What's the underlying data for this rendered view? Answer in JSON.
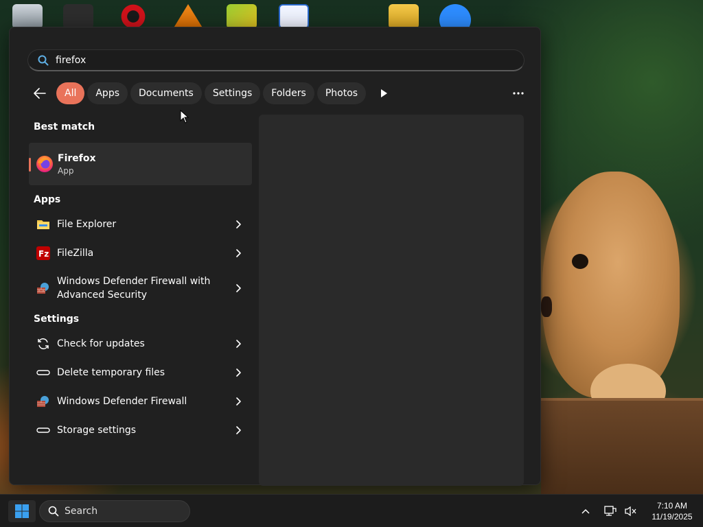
{
  "search": {
    "query": "firefox"
  },
  "filters": [
    {
      "label": "All",
      "active": true
    },
    {
      "label": "Apps"
    },
    {
      "label": "Documents"
    },
    {
      "label": "Settings"
    },
    {
      "label": "Folders"
    },
    {
      "label": "Photos"
    }
  ],
  "best_match": {
    "section": "Best match",
    "name": "Firefox",
    "type": "App",
    "icon": "firefox-icon"
  },
  "apps": {
    "section": "Apps",
    "items": [
      {
        "label": "File Explorer",
        "icon": "folder-icon"
      },
      {
        "label": "FileZilla",
        "icon": "filezilla-icon"
      },
      {
        "label": "Windows Defender Firewall with Advanced Security",
        "icon": "firewall-advanced-icon"
      }
    ]
  },
  "settings": {
    "section": "Settings",
    "items": [
      {
        "label": "Check for updates",
        "icon": "sync-icon"
      },
      {
        "label": "Delete temporary files",
        "icon": "storage-icon"
      },
      {
        "label": "Windows Defender Firewall",
        "icon": "firewall-icon"
      },
      {
        "label": "Storage settings",
        "icon": "storage-icon"
      }
    ]
  },
  "taskbar": {
    "search_label": "Search",
    "time": "7:10 AM",
    "date": "11/19/2025"
  },
  "colors": {
    "accent": "#e9735a",
    "panel_bg": "#202020",
    "chip_bg": "#2d2d2d"
  }
}
